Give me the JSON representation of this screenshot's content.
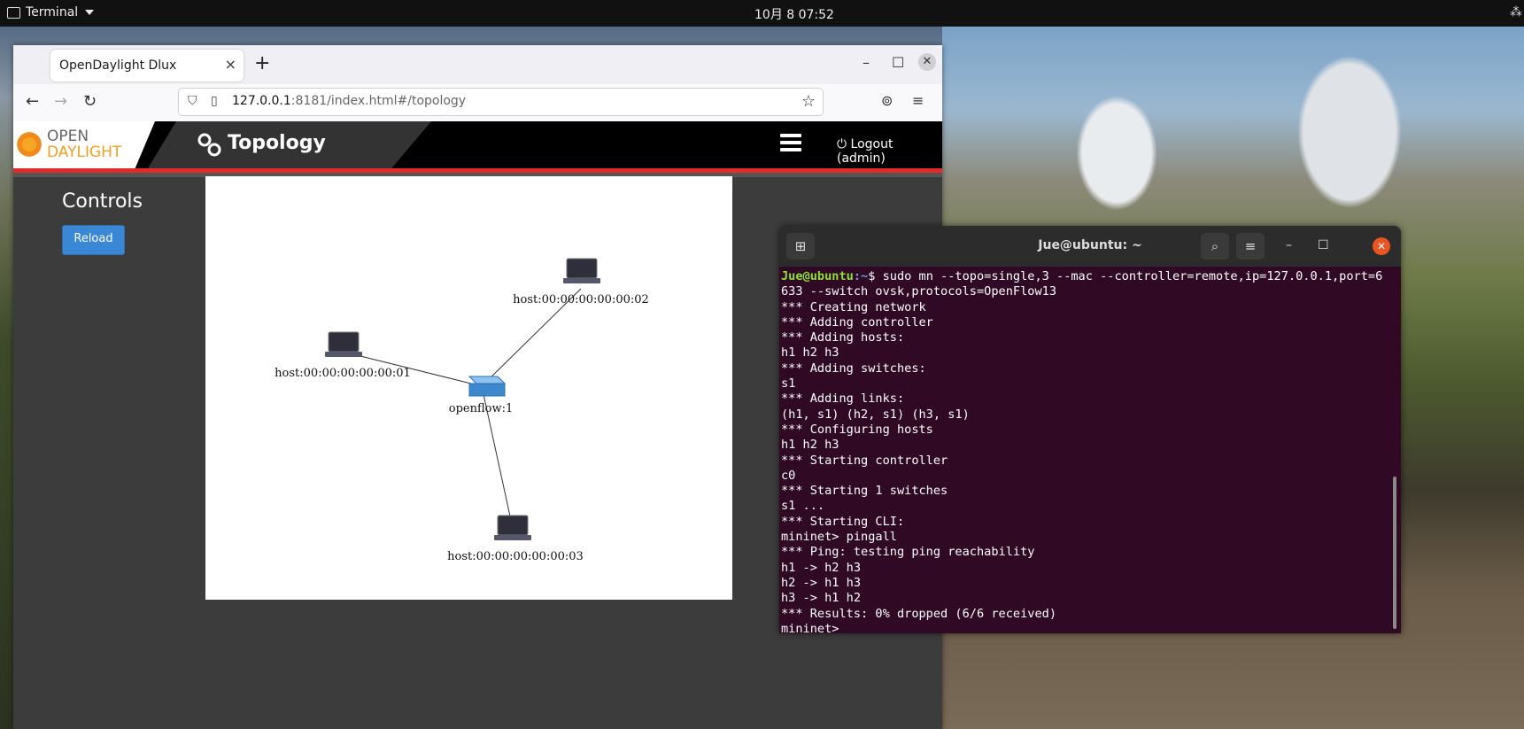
{
  "topbar": {
    "app_name": "Terminal",
    "clock": "10月 8  07:52"
  },
  "browser": {
    "tab_title": "OpenDaylight Dlux",
    "tab_close": "×",
    "new_tab": "+",
    "url_host": "127.0.0.1",
    "url_rest": ":8181/index.html#/topology"
  },
  "odl": {
    "logo_line1": "OPEN",
    "logo_line2": "DAYLIGHT",
    "page_title": "Topology",
    "logout": "Logout (admin)",
    "controls_title": "Controls",
    "reload_button": "Reload"
  },
  "topology": {
    "switch": {
      "label": "openflow:1"
    },
    "hosts": [
      {
        "label": "host:00:00:00:00:00:01"
      },
      {
        "label": "host:00:00:00:00:00:02"
      },
      {
        "label": "host:00:00:00:00:00:03"
      }
    ]
  },
  "terminal": {
    "title": "Jue@ubuntu: ~",
    "prompt_user": "Jue@ubuntu",
    "prompt_path": ":~",
    "command": "$ sudo mn --topo=single,3 --mac --controller=remote,ip=127.0.0.1,port=6633 --switch ovsk,protocols=OpenFlow13",
    "output": [
      "*** Creating network",
      "*** Adding controller",
      "*** Adding hosts:",
      "h1 h2 h3",
      "*** Adding switches:",
      "s1",
      "*** Adding links:",
      "(h1, s1) (h2, s1) (h3, s1)",
      "*** Configuring hosts",
      "h1 h2 h3",
      "*** Starting controller",
      "c0",
      "*** Starting 1 switches",
      "s1 ...",
      "*** Starting CLI:",
      "mininet> pingall",
      "*** Ping: testing ping reachability",
      "h1 -> h2 h3",
      "h2 -> h1 h3",
      "h3 -> h1 h2",
      "*** Results: 0% dropped (6/6 received)",
      "mininet> "
    ]
  },
  "colors": {
    "odl_red": "#e32b2b",
    "reload_blue": "#3a87d6",
    "terminal_bg": "#300a24",
    "terminal_close": "#e95420"
  }
}
